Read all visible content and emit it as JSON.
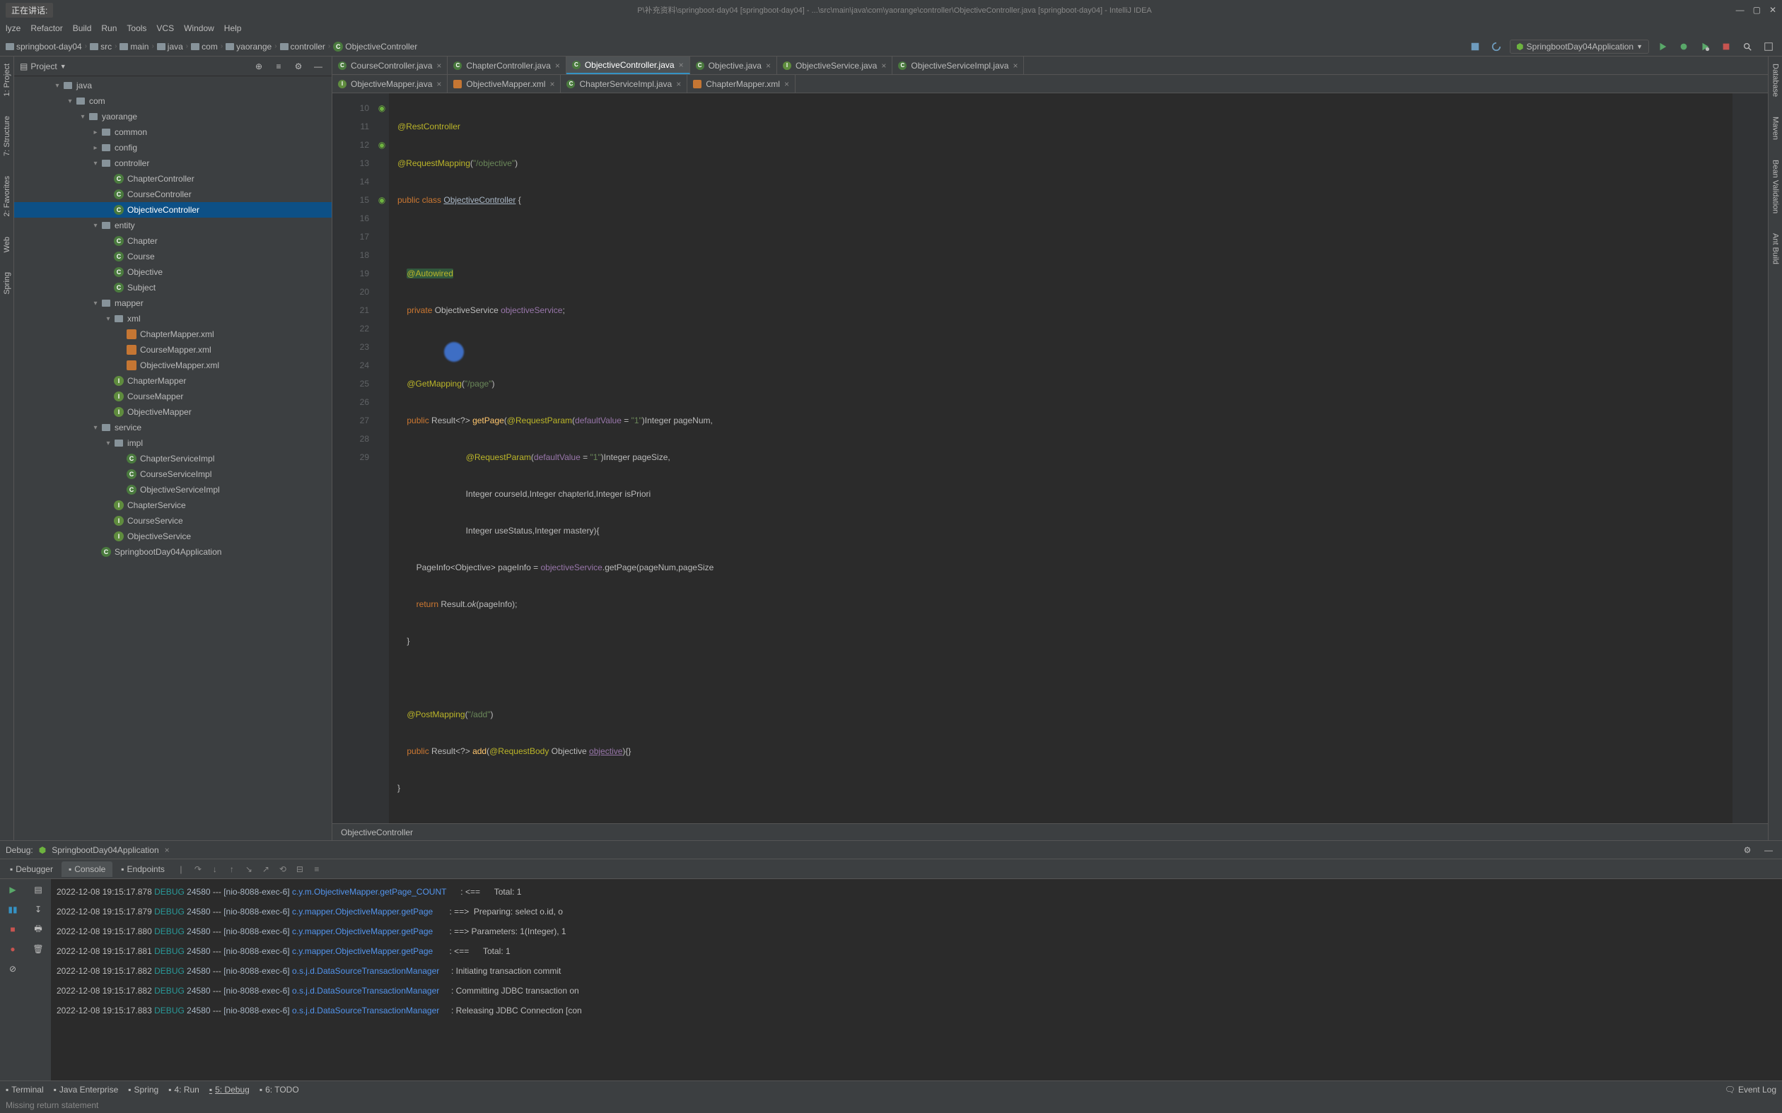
{
  "titlebar": {
    "speaking": "正在讲话:",
    "path": "P\\补充资料\\springboot-day04 [springboot-day04] - ...\\src\\main\\java\\com\\yaorange\\controller\\ObjectiveController.java [springboot-day04] - IntelliJ IDEA"
  },
  "menu": [
    "lyze",
    "Refactor",
    "Build",
    "Run",
    "Tools",
    "VCS",
    "Window",
    "Help"
  ],
  "breadcrumbs": [
    "springboot-day04",
    "src",
    "main",
    "java",
    "com",
    "yaorange",
    "controller",
    "ObjectiveController"
  ],
  "runConfig": "SpringbootDay04Application",
  "projectHeader": "Project",
  "tree": [
    {
      "d": 3,
      "arrow": "▾",
      "icon": "folder",
      "label": "java"
    },
    {
      "d": 4,
      "arrow": "▾",
      "icon": "folder",
      "label": "com"
    },
    {
      "d": 5,
      "arrow": "▾",
      "icon": "folder",
      "label": "yaorange"
    },
    {
      "d": 6,
      "arrow": "▸",
      "icon": "folder",
      "label": "common"
    },
    {
      "d": 6,
      "arrow": "▸",
      "icon": "folder",
      "label": "config"
    },
    {
      "d": 6,
      "arrow": "▾",
      "icon": "folder",
      "label": "controller"
    },
    {
      "d": 7,
      "arrow": "",
      "icon": "class",
      "label": "ChapterController"
    },
    {
      "d": 7,
      "arrow": "",
      "icon": "class",
      "label": "CourseController"
    },
    {
      "d": 7,
      "arrow": "",
      "icon": "class",
      "label": "ObjectiveController",
      "selected": true
    },
    {
      "d": 6,
      "arrow": "▾",
      "icon": "folder",
      "label": "entity"
    },
    {
      "d": 7,
      "arrow": "",
      "icon": "class",
      "label": "Chapter"
    },
    {
      "d": 7,
      "arrow": "",
      "icon": "class",
      "label": "Course"
    },
    {
      "d": 7,
      "arrow": "",
      "icon": "class",
      "label": "Objective"
    },
    {
      "d": 7,
      "arrow": "",
      "icon": "class",
      "label": "Subject"
    },
    {
      "d": 6,
      "arrow": "▾",
      "icon": "folder",
      "label": "mapper"
    },
    {
      "d": 7,
      "arrow": "▾",
      "icon": "folder",
      "label": "xml"
    },
    {
      "d": 8,
      "arrow": "",
      "icon": "xml",
      "label": "ChapterMapper.xml"
    },
    {
      "d": 8,
      "arrow": "",
      "icon": "xml",
      "label": "CourseMapper.xml"
    },
    {
      "d": 8,
      "arrow": "",
      "icon": "xml",
      "label": "ObjectiveMapper.xml"
    },
    {
      "d": 7,
      "arrow": "",
      "icon": "interface",
      "label": "ChapterMapper"
    },
    {
      "d": 7,
      "arrow": "",
      "icon": "interface",
      "label": "CourseMapper"
    },
    {
      "d": 7,
      "arrow": "",
      "icon": "interface",
      "label": "ObjectiveMapper"
    },
    {
      "d": 6,
      "arrow": "▾",
      "icon": "folder",
      "label": "service"
    },
    {
      "d": 7,
      "arrow": "▾",
      "icon": "folder",
      "label": "impl"
    },
    {
      "d": 8,
      "arrow": "",
      "icon": "class",
      "label": "ChapterServiceImpl"
    },
    {
      "d": 8,
      "arrow": "",
      "icon": "class",
      "label": "CourseServiceImpl"
    },
    {
      "d": 8,
      "arrow": "",
      "icon": "class",
      "label": "ObjectiveServiceImpl"
    },
    {
      "d": 7,
      "arrow": "",
      "icon": "interface",
      "label": "ChapterService"
    },
    {
      "d": 7,
      "arrow": "",
      "icon": "interface",
      "label": "CourseService"
    },
    {
      "d": 7,
      "arrow": "",
      "icon": "interface",
      "label": "ObjectiveService"
    },
    {
      "d": 6,
      "arrow": "",
      "icon": "class",
      "label": "SpringbootDay04Application"
    }
  ],
  "tabRow1": [
    {
      "label": "CourseController.java",
      "icon": "class"
    },
    {
      "label": "ChapterController.java",
      "icon": "class"
    },
    {
      "label": "ObjectiveController.java",
      "icon": "class",
      "active": true
    },
    {
      "label": "Objective.java",
      "icon": "class"
    },
    {
      "label": "ObjectiveService.java",
      "icon": "interface"
    },
    {
      "label": "ObjectiveServiceImpl.java",
      "icon": "class"
    }
  ],
  "tabRow2": [
    {
      "label": "ObjectiveMapper.java",
      "icon": "interface"
    },
    {
      "label": "ObjectiveMapper.xml",
      "icon": "xml"
    },
    {
      "label": "ChapterServiceImpl.java",
      "icon": "class"
    },
    {
      "label": "ChapterMapper.xml",
      "icon": "xml"
    }
  ],
  "lineStart": 10,
  "lineEnd": 29,
  "breadcrumbBottom": "ObjectiveController",
  "debugHeader": {
    "label": "Debug:",
    "config": "SpringbootDay04Application"
  },
  "debugTabs": [
    {
      "label": "Debugger",
      "icon": "bug"
    },
    {
      "label": "Console",
      "icon": "console",
      "active": true
    },
    {
      "label": "Endpoints",
      "icon": "endpoint"
    }
  ],
  "logs": [
    {
      "time": "2022-12-08 19:15:17.878",
      "level": "DEBUG",
      "pid": "24580",
      "thread": "[nio-8088-exec-6]",
      "cls": "c.y.m.ObjectiveMapper.getPage_COUNT",
      "msg": ": <==      Total: 1"
    },
    {
      "time": "2022-12-08 19:15:17.879",
      "level": "DEBUG",
      "pid": "24580",
      "thread": "[nio-8088-exec-6]",
      "cls": "c.y.mapper.ObjectiveMapper.getPage",
      "msg": ": ==>  Preparing: select o.id, o"
    },
    {
      "time": "2022-12-08 19:15:17.880",
      "level": "DEBUG",
      "pid": "24580",
      "thread": "[nio-8088-exec-6]",
      "cls": "c.y.mapper.ObjectiveMapper.getPage",
      "msg": ": ==> Parameters: 1(Integer), 1"
    },
    {
      "time": "2022-12-08 19:15:17.881",
      "level": "DEBUG",
      "pid": "24580",
      "thread": "[nio-8088-exec-6]",
      "cls": "c.y.mapper.ObjectiveMapper.getPage",
      "msg": ": <==      Total: 1"
    },
    {
      "time": "2022-12-08 19:15:17.882",
      "level": "DEBUG",
      "pid": "24580",
      "thread": "[nio-8088-exec-6]",
      "cls": "o.s.j.d.DataSourceTransactionManager",
      "msg": ": Initiating transaction commit"
    },
    {
      "time": "2022-12-08 19:15:17.882",
      "level": "DEBUG",
      "pid": "24580",
      "thread": "[nio-8088-exec-6]",
      "cls": "o.s.j.d.DataSourceTransactionManager",
      "msg": ": Committing JDBC transaction on"
    },
    {
      "time": "2022-12-08 19:15:17.883",
      "level": "DEBUG",
      "pid": "24580",
      "thread": "[nio-8088-exec-6]",
      "cls": "o.s.j.d.DataSourceTransactionManager",
      "msg": ": Releasing JDBC Connection [con"
    }
  ],
  "bottomTabs": [
    {
      "label": "Terminal",
      "u": "2"
    },
    {
      "label": "Java Enterprise",
      "u": ""
    },
    {
      "label": "Spring",
      "u": ""
    },
    {
      "label": "4: Run",
      "u": "4"
    },
    {
      "label": "5: Debug",
      "u": "5",
      "active": true
    },
    {
      "label": "6: TODO",
      "u": "6"
    }
  ],
  "eventLog": "Event Log",
  "statusLeft": "Missing return statement",
  "leftGutter": [
    "1: Project",
    "7: Structure"
  ],
  "leftGutterExtra": [
    "2: Favorites",
    "Web",
    "Spring"
  ],
  "rightGutter": [
    "Database",
    "Maven",
    "Bean Validation",
    "Ant Build"
  ]
}
